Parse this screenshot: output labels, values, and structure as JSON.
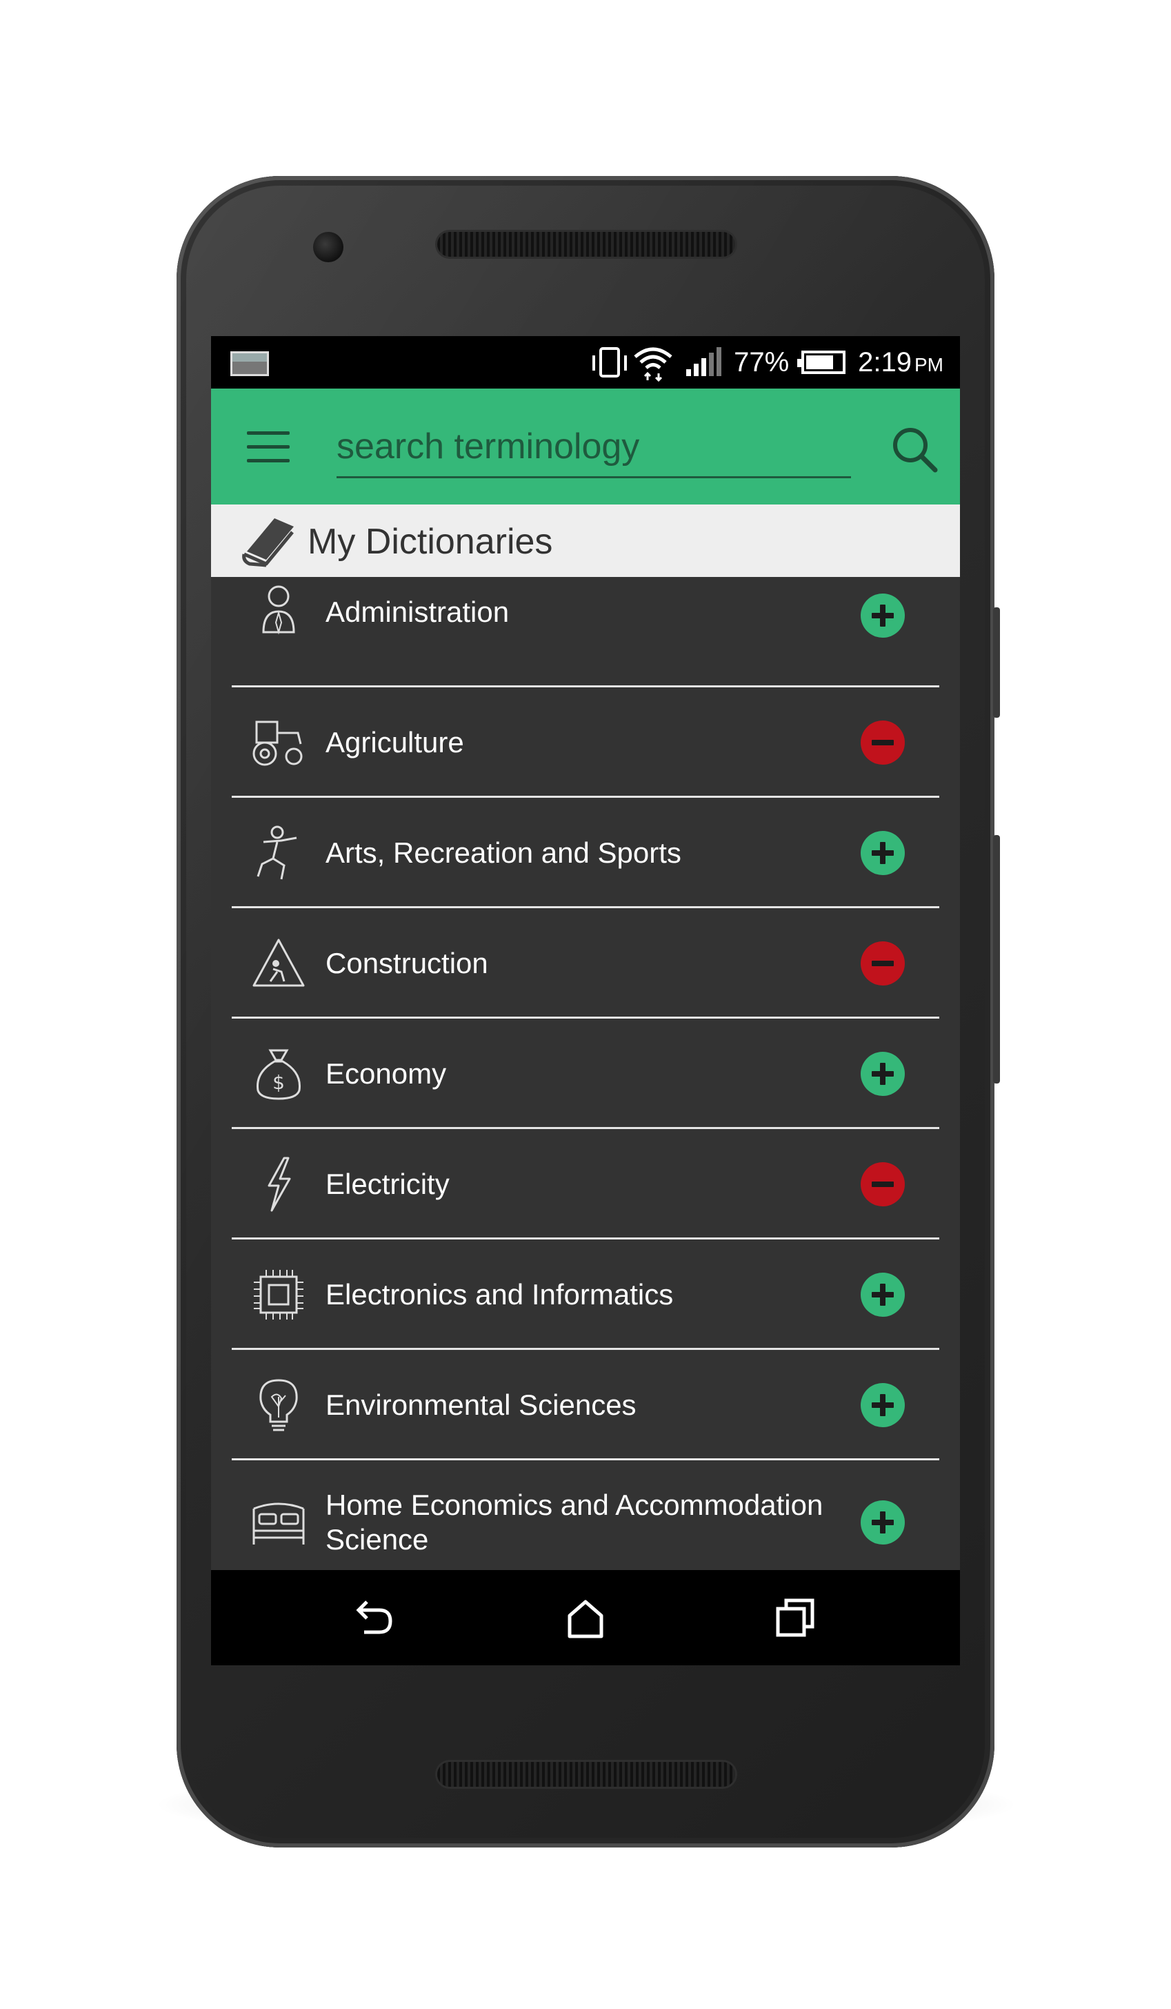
{
  "status_bar": {
    "battery_percent": "77%",
    "battery_level": 0.77,
    "time": "2:19",
    "ampm": "PM"
  },
  "app_bar": {
    "search_placeholder": "search terminology",
    "accent_color": "#35b879"
  },
  "section": {
    "title": "My Dictionaries"
  },
  "dictionaries": [
    {
      "label": "Administration",
      "icon": "person-tie-icon",
      "state": "add"
    },
    {
      "label": "Agriculture",
      "icon": "tractor-icon",
      "state": "remove"
    },
    {
      "label": "Arts, Recreation and Sports",
      "icon": "runner-icon",
      "state": "add"
    },
    {
      "label": "Construction",
      "icon": "construction-sign-icon",
      "state": "remove"
    },
    {
      "label": "Economy",
      "icon": "money-bag-icon",
      "state": "add"
    },
    {
      "label": "Electricity",
      "icon": "lightning-icon",
      "state": "remove"
    },
    {
      "label": "Electronics and Informatics",
      "icon": "chip-icon",
      "state": "add"
    },
    {
      "label": "Environmental Sciences",
      "icon": "eco-bulb-icon",
      "state": "add"
    },
    {
      "label": "Home Economics and Accommodation Science",
      "icon": "bed-icon",
      "state": "add"
    }
  ],
  "colors": {
    "add": "#35b879",
    "remove": "#c1121c",
    "list_background": "#333333"
  },
  "nav_bar": {
    "buttons": [
      "back-icon",
      "home-icon",
      "recent-apps-icon"
    ]
  }
}
